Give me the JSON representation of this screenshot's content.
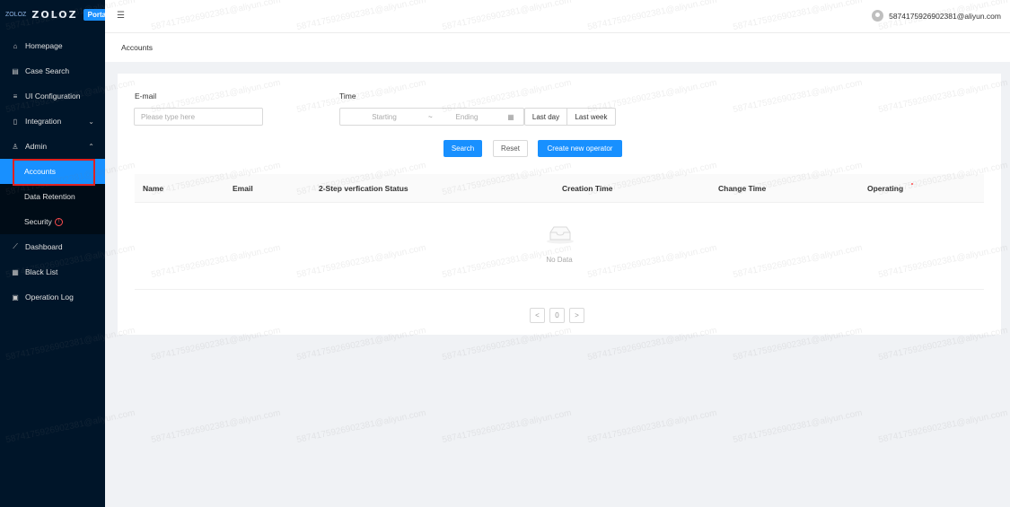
{
  "brand": {
    "logo": "ZOLOZ",
    "logo_mark": "ZOLOZ",
    "badge": "Portal"
  },
  "sidebar": {
    "items": [
      {
        "label": "Homepage",
        "icon": "home-icon"
      },
      {
        "label": "Case Search",
        "icon": "table-icon"
      },
      {
        "label": "UI Configuration",
        "icon": "menu-icon"
      },
      {
        "label": "Integration",
        "icon": "file-icon"
      },
      {
        "label": "Admin",
        "icon": "user-admin-icon"
      },
      {
        "label": "Accounts"
      },
      {
        "label": "Data Retention"
      },
      {
        "label": "Security"
      },
      {
        "label": "Dashboard",
        "icon": "line-chart-icon"
      },
      {
        "label": "Black List",
        "icon": "blacklist-icon"
      },
      {
        "label": "Operation Log",
        "icon": "log-icon"
      }
    ],
    "active_color": "#1890ff",
    "bg_color": "#001529"
  },
  "header": {
    "user": "5874175926902381@aliyun.com"
  },
  "breadcrumb": "Accounts",
  "filters": {
    "email_label": "E-mail",
    "email_placeholder": "Please type here",
    "time_label": "Time",
    "starting": "Starting",
    "separator": "~",
    "ending": "Ending",
    "last_day": "Last day",
    "last_week": "Last week"
  },
  "actions": {
    "search": "Search",
    "reset": "Reset",
    "create": "Create new operator"
  },
  "table": {
    "columns": [
      "Name",
      "Email",
      "2-Step verfication Status",
      "Creation Time",
      "Change Time",
      "Operating"
    ],
    "empty_text": "No Data"
  },
  "pagination": {
    "prev": "<",
    "page": "0",
    "next": ">"
  },
  "watermark": "5874175926902381@aliyun.com"
}
